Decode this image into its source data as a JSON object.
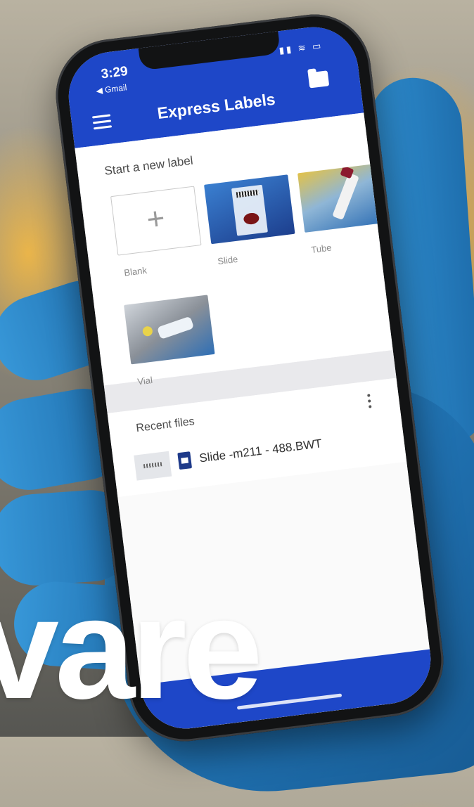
{
  "status_bar": {
    "time": "3:29",
    "back_app": "◀ Gmail",
    "icons": "▮▮ ≋ ▭"
  },
  "app_bar": {
    "title": "Express Labels"
  },
  "start_section": {
    "heading": "Start a new label",
    "templates": [
      {
        "label": "Blank"
      },
      {
        "label": "Slide"
      },
      {
        "label": "Tube"
      },
      {
        "label": "Vial"
      }
    ]
  },
  "recent_section": {
    "heading": "Recent files",
    "files": [
      {
        "name": "Slide -m211 - 488.BWT"
      }
    ]
  },
  "overlay": {
    "text": "vare"
  },
  "colors": {
    "brand_blue": "#1e47c8",
    "glove_blue": "#1f6fae"
  }
}
